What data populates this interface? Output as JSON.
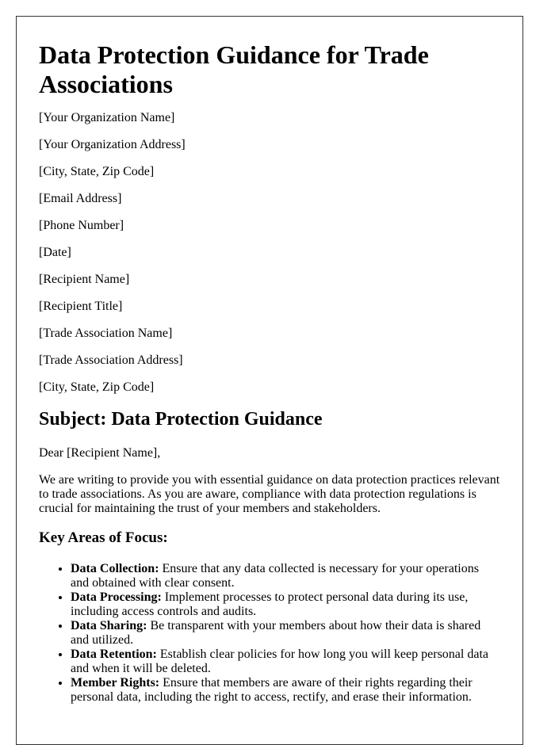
{
  "document": {
    "title": "Data Protection Guidance for Trade Associations",
    "sender": [
      "[Your Organization Name]",
      "[Your Organization Address]",
      "[City, State, Zip Code]",
      "[Email Address]",
      "[Phone Number]",
      "[Date]"
    ],
    "recipient": [
      "[Recipient Name]",
      "[Recipient Title]",
      "[Trade Association Name]",
      "[Trade Association Address]",
      "[City, State, Zip Code]"
    ],
    "subject": "Subject: Data Protection Guidance",
    "greeting": "Dear [Recipient Name],",
    "intro": "We are writing to provide you with essential guidance on data protection practices relevant to trade associations. As you are aware, compliance with data protection regulations is crucial for maintaining the trust of your members and stakeholders.",
    "focus_heading": "Key Areas of Focus:",
    "focus_items": [
      {
        "term": "Data Collection:",
        "text": " Ensure that any data collected is necessary for your operations and obtained with clear consent."
      },
      {
        "term": "Data Processing:",
        "text": " Implement processes to protect personal data during its use, including access controls and audits."
      },
      {
        "term": "Data Sharing:",
        "text": " Be transparent with your members about how their data is shared and utilized."
      },
      {
        "term": "Data Retention:",
        "text": " Establish clear policies for how long you will keep personal data and when it will be deleted."
      },
      {
        "term": "Member Rights:",
        "text": " Ensure that members are aware of their rights regarding their personal data, including the right to access, rectify, and erase their information."
      }
    ]
  }
}
